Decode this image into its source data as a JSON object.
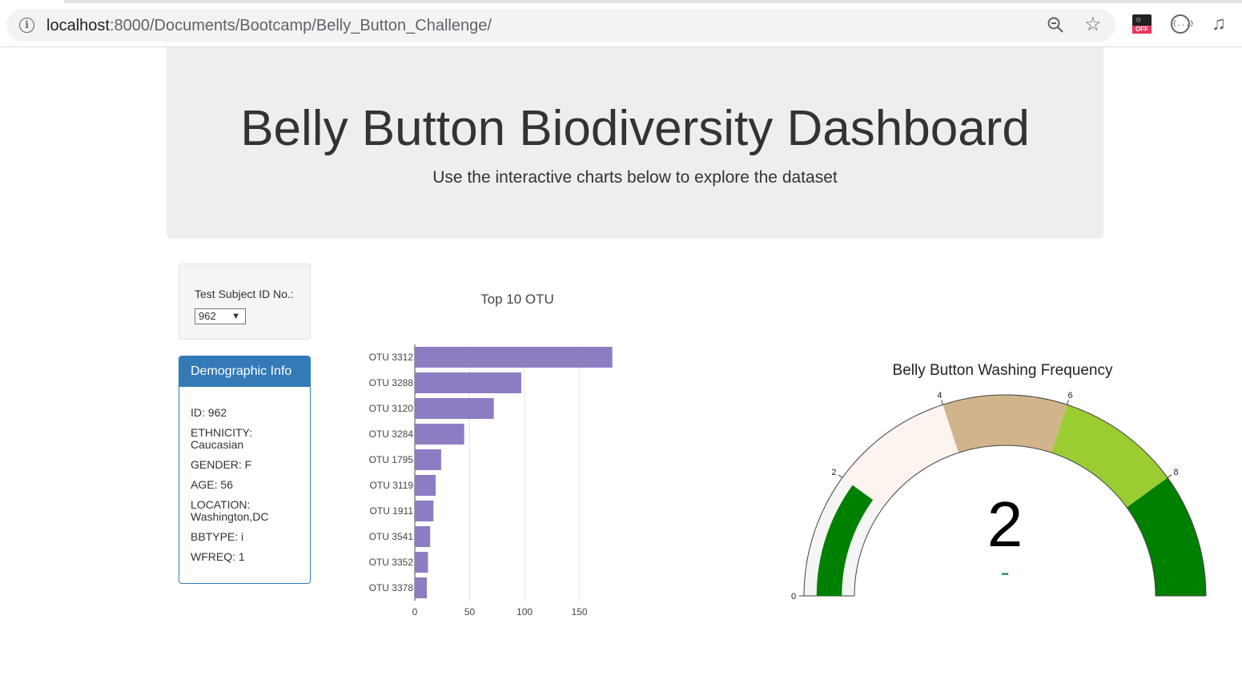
{
  "browser": {
    "info_glyph": "i",
    "url_host": "localhost",
    "url_path": ":8000/Documents/Bootcamp/Belly_Button_Challenge/",
    "ext_badge": "OFF",
    "ext2_glyph": "{...}",
    "ext3_glyph": "♫",
    "star_glyph": "☆",
    "ext1_glyph": "☼"
  },
  "header": {
    "title": "Belly Button Biodiversity Dashboard",
    "subtitle": "Use the interactive charts below to explore the dataset"
  },
  "selector": {
    "label": "Test Subject ID No.:",
    "value": "962",
    "arrow": "▼"
  },
  "demographic": {
    "title": "Demographic Info",
    "rows": [
      [
        "ID: 962"
      ],
      [
        "ETHNICITY:",
        "Caucasian"
      ],
      [
        "GENDER: F"
      ],
      [
        "AGE: 56"
      ],
      [
        "LOCATION:",
        "Washington,DC"
      ],
      [
        "BBTYPE: i"
      ],
      [
        "WFREQ: 1"
      ]
    ]
  },
  "chart_data": [
    {
      "type": "bar",
      "orientation": "horizontal",
      "title": "Top 10 OTU",
      "categories": [
        "OTU 3312",
        "OTU 3288",
        "OTU 3120",
        "OTU 3284",
        "OTU 1795",
        "OTU 3119",
        "OTU 1911",
        "OTU 3541",
        "OTU 3352",
        "OTU 3378"
      ],
      "values": [
        180,
        97,
        72,
        45,
        24,
        19,
        17,
        14,
        12,
        11
      ],
      "xticks": [
        0,
        50,
        100,
        150
      ],
      "xlim": [
        0,
        197
      ],
      "color": "#8e7cc3",
      "grid": true
    },
    {
      "type": "gauge",
      "title": "Belly Button Washing Frequency",
      "value": 2,
      "value_label": "2",
      "delta_label": "-",
      "range": [
        0,
        10
      ],
      "ticks": [
        0,
        2,
        4,
        6,
        8
      ],
      "steps": [
        {
          "range": [
            0,
            2
          ],
          "color": "#f5f5f5"
        },
        {
          "range": [
            2,
            4
          ],
          "color": "#fdf4ef"
        },
        {
          "range": [
            4,
            6
          ],
          "color": "#d2b48c"
        },
        {
          "range": [
            6,
            8
          ],
          "color": "#9acd32"
        },
        {
          "range": [
            8,
            10
          ],
          "color": "#008000"
        }
      ],
      "bar_color": "#008000",
      "delta_color": "#3d9970"
    }
  ]
}
